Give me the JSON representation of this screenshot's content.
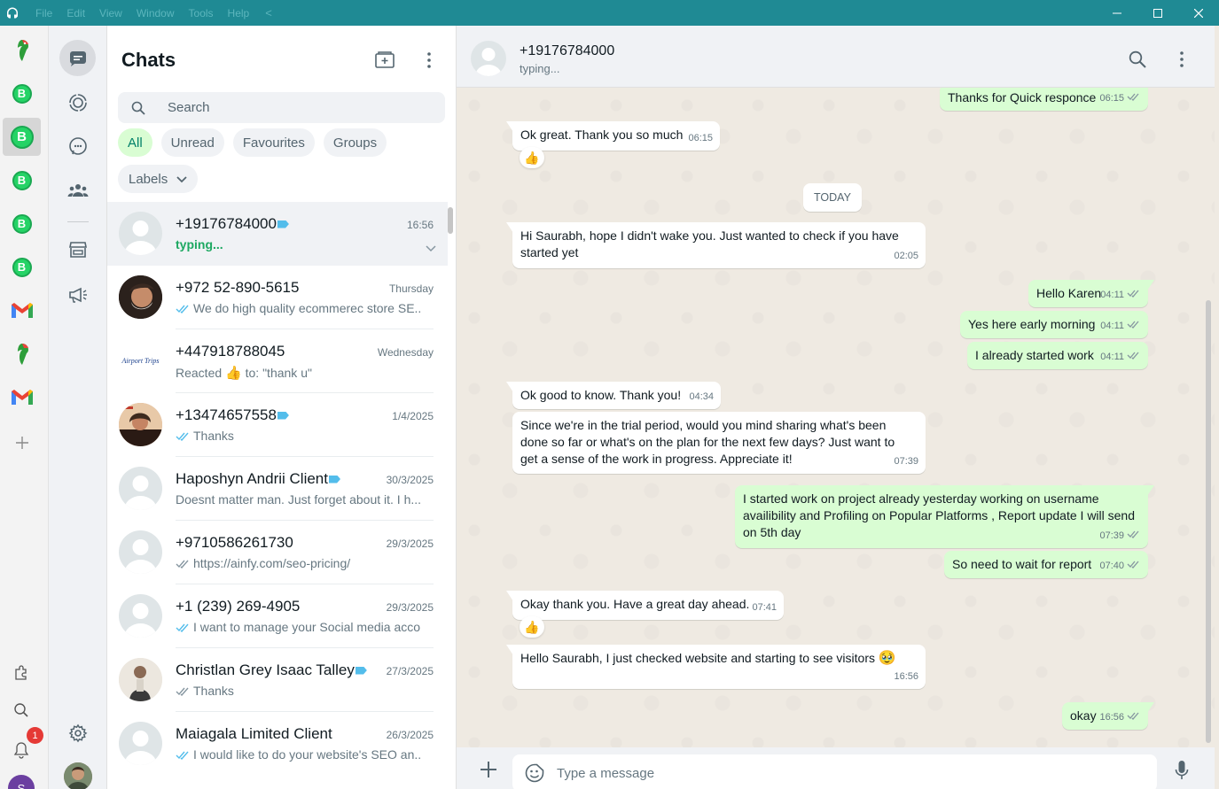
{
  "window": {
    "menu": [
      "File",
      "Edit",
      "View",
      "Window",
      "Tools",
      "Help"
    ],
    "back_glyph": "<"
  },
  "apprail": {
    "notification_count": "1",
    "b_letter": "B",
    "profile_letter": "S"
  },
  "chatlist": {
    "title": "Chats",
    "search_placeholder": "Search",
    "filters": [
      "All",
      "Unread",
      "Favourites",
      "Groups"
    ],
    "labels_chip": "Labels",
    "chats": [
      {
        "name": "+19176784000",
        "time": "16:56",
        "preview": "typing...",
        "typing": true,
        "tag": true
      },
      {
        "name": "+972 52-890-5615",
        "time": "Thursday",
        "preview": "We do high quality ecommerec store SE...",
        "ticks": true
      },
      {
        "name": "+447918788045",
        "time": "Wednesday",
        "preview_prefix": "Reacted",
        "preview_emoji": "👍",
        "preview": "to: \"thank u\""
      },
      {
        "name": "+13474657558",
        "time": "1/4/2025",
        "preview": "Thanks",
        "ticks": true,
        "tag": true
      },
      {
        "name": "Haposhyn Andrii Client",
        "time": "30/3/2025",
        "preview": "Doesnt matter man. Just forget about it. I h...",
        "tag": true
      },
      {
        "name": "+9710586261730",
        "time": "29/3/2025",
        "preview": "https://ainfy.com/seo-pricing/",
        "ticks": true
      },
      {
        "name": "+1 (239) 269-4905",
        "time": "29/3/2025",
        "preview": "I want to manage your Social media acco...",
        "ticks": true
      },
      {
        "name": "Christlan Grey Isaac Talley",
        "time": "27/3/2025",
        "preview": "Thanks",
        "ticks": true,
        "tag": true
      },
      {
        "name": "Maiagala Limited Client",
        "time": "26/3/2025",
        "preview": "I would like to do your website's SEO an...",
        "ticks": true
      }
    ],
    "airport_logo_text": "Airport Trips"
  },
  "conversation": {
    "name": "+19176784000",
    "status": "typing...",
    "day_chip": "TODAY",
    "input_placeholder": "Type a message",
    "messages": [
      {
        "dir": "out",
        "text": "Thanks for Quick responce",
        "time": "06:15"
      },
      {
        "dir": "in",
        "text": "Ok great. Thank you so much",
        "time": "06:15",
        "reaction": "👍"
      },
      {
        "dir": "in",
        "text": "Hi Saurabh, hope I didn't wake you. Just wanted to check if you have started yet",
        "time": "02:05"
      },
      {
        "dir": "out",
        "text": "Hello Karen",
        "time": "04:11"
      },
      {
        "dir": "out",
        "text": "Yes here early morning",
        "time": "04:11"
      },
      {
        "dir": "out",
        "text": "I already started work",
        "time": "04:11"
      },
      {
        "dir": "in",
        "text": "Ok good to know. Thank you!",
        "time": "04:34"
      },
      {
        "dir": "in",
        "text": "Since we're in the trial period, would you mind sharing what's been done so far or what's on the plan for the next few days? Just want to get a sense of the work in progress. Appreciate it!",
        "time": "07:39"
      },
      {
        "dir": "out",
        "text": "I started work on project already yesterday working on username availibility and Profiling on Popular Platforms , Report update I will send on 5th day",
        "time": "07:39"
      },
      {
        "dir": "out",
        "text": "So need to wait for report",
        "time": "07:40"
      },
      {
        "dir": "in",
        "text": "Okay thank you. Have a great day ahead.",
        "time": "07:41",
        "reaction": "👍"
      },
      {
        "dir": "in",
        "text": "Hello Saurabh, I just checked website and starting to see visitors",
        "emoji": "🥹",
        "time": "16:56"
      },
      {
        "dir": "out",
        "text": "okay",
        "time": "16:56"
      }
    ]
  },
  "colors": {
    "titlebar": "#1f8a94",
    "accent": "#25d366",
    "out_bubble": "#d9fdd3",
    "tick_blue": "#53bdeb"
  }
}
